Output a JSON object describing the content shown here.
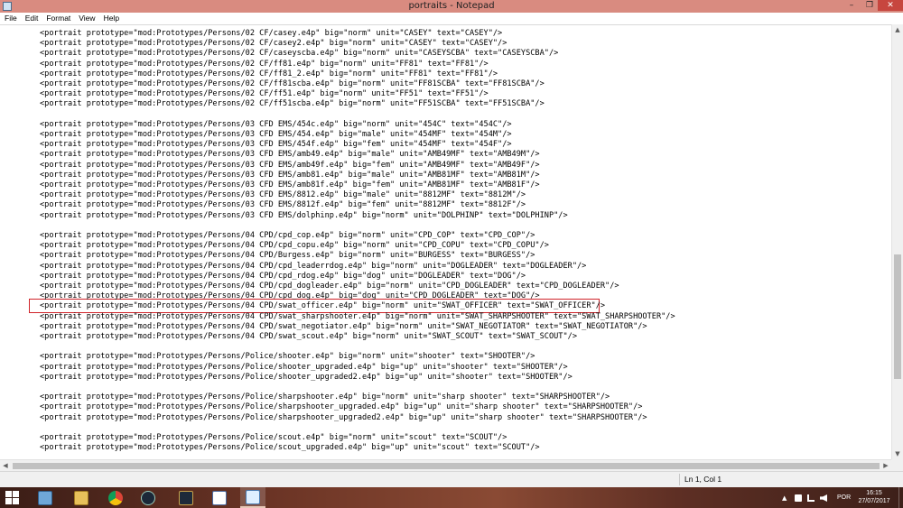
{
  "window": {
    "title": "portraits - Notepad",
    "minimize_glyph": "–",
    "maximize_glyph": "❐",
    "close_glyph": "✕"
  },
  "menu": [
    "File",
    "Edit",
    "Format",
    "View",
    "Help"
  ],
  "editor": {
    "lines": [
      "<portrait prototype=\"mod:Prototypes/Persons/02 CF/casey.e4p\" big=\"norm\" unit=\"CASEY\" text=\"CASEY\"/>",
      "<portrait prototype=\"mod:Prototypes/Persons/02 CF/casey2.e4p\" big=\"norm\" unit=\"CASEY\" text=\"CASEY\"/>",
      "<portrait prototype=\"mod:Prototypes/Persons/02 CF/caseyscba.e4p\" big=\"norm\" unit=\"CASEYSCBA\" text=\"CASEYSCBA\"/>",
      "<portrait prototype=\"mod:Prototypes/Persons/02 CF/ff81.e4p\" big=\"norm\" unit=\"FF81\" text=\"FF81\"/>",
      "<portrait prototype=\"mod:Prototypes/Persons/02 CF/ff81_2.e4p\" big=\"norm\" unit=\"FF81\" text=\"FF81\"/>",
      "<portrait prototype=\"mod:Prototypes/Persons/02 CF/ff81scba.e4p\" big=\"norm\" unit=\"FF81SCBA\" text=\"FF81SCBA\"/>",
      "<portrait prototype=\"mod:Prototypes/Persons/02 CF/ff51.e4p\" big=\"norm\" unit=\"FF51\" text=\"FF51\"/>",
      "<portrait prototype=\"mod:Prototypes/Persons/02 CF/ff51scba.e4p\" big=\"norm\" unit=\"FF51SCBA\" text=\"FF51SCBA\"/>",
      "",
      "<portrait prototype=\"mod:Prototypes/Persons/03 CFD EMS/454c.e4p\" big=\"norm\" unit=\"454C\" text=\"454C\"/>",
      "<portrait prototype=\"mod:Prototypes/Persons/03 CFD EMS/454.e4p\" big=\"male\" unit=\"454MF\" text=\"454M\"/>",
      "<portrait prototype=\"mod:Prototypes/Persons/03 CFD EMS/454f.e4p\" big=\"fem\" unit=\"454MF\" text=\"454F\"/>",
      "<portrait prototype=\"mod:Prototypes/Persons/03 CFD EMS/amb49.e4p\" big=\"male\" unit=\"AMB49MF\" text=\"AMB49M\"/>",
      "<portrait prototype=\"mod:Prototypes/Persons/03 CFD EMS/amb49f.e4p\" big=\"fem\" unit=\"AMB49MF\" text=\"AMB49F\"/>",
      "<portrait prototype=\"mod:Prototypes/Persons/03 CFD EMS/amb81.e4p\" big=\"male\" unit=\"AMB81MF\" text=\"AMB81M\"/>",
      "<portrait prototype=\"mod:Prototypes/Persons/03 CFD EMS/amb81f.e4p\" big=\"fem\" unit=\"AMB81MF\" text=\"AMB81F\"/>",
      "<portrait prototype=\"mod:Prototypes/Persons/03 CFD EMS/8812.e4p\" big=\"male\" unit=\"8812MF\" text=\"8812M\"/>",
      "<portrait prototype=\"mod:Prototypes/Persons/03 CFD EMS/8812f.e4p\" big=\"fem\" unit=\"8812MF\" text=\"8812F\"/>",
      "<portrait prototype=\"mod:Prototypes/Persons/03 CFD EMS/dolphinp.e4p\" big=\"norm\" unit=\"DOLPHINP\" text=\"DOLPHINP\"/>",
      "",
      "<portrait prototype=\"mod:Prototypes/Persons/04 CPD/cpd_cop.e4p\" big=\"norm\" unit=\"CPD_COP\" text=\"CPD_COP\"/>",
      "<portrait prototype=\"mod:Prototypes/Persons/04 CPD/cpd_copu.e4p\" big=\"norm\" unit=\"CPD_COPU\" text=\"CPD_COPU\"/>",
      "<portrait prototype=\"mod:Prototypes/Persons/04 CPD/Burgess.e4p\" big=\"norm\" unit=\"BURGESS\" text=\"BURGESS\"/>",
      "<portrait prototype=\"mod:Prototypes/Persons/04 CPD/cpd_leaderrdog.e4p\" big=\"norm\" unit=\"DOGLEADER\" text=\"DOGLEADER\"/>",
      "<portrait prototype=\"mod:Prototypes/Persons/04 CPD/cpd_rdog.e4p\" big=\"dog\" unit=\"DOGLEADER\" text=\"DOG\"/>",
      "<portrait prototype=\"mod:Prototypes/Persons/04 CPD/cpd_dogleader.e4p\" big=\"norm\" unit=\"CPD_DOGLEADER\" text=\"CPD_DOGLEADER\"/>",
      "<portrait prototype=\"mod:Prototypes/Persons/04 CPD/cpd_dog.e4p\" big=\"dog\" unit=\"CPD_DOGLEADER\" text=\"DOG\"/>",
      "<portrait prototype=\"mod:Prototypes/Persons/04 CPD/swat_officer.e4p\" big=\"norm\" unit=\"SWAT_OFFICER\" text=\"SWAT_OFFICER\"/>",
      "<portrait prototype=\"mod:Prototypes/Persons/04 CPD/swat_sharpshooter.e4p\" big=\"norm\" unit=\"SWAT_SHARPSHOOTER\" text=\"SWAT_SHARPSHOOTER\"/>",
      "<portrait prototype=\"mod:Prototypes/Persons/04 CPD/swat_negotiator.e4p\" big=\"norm\" unit=\"SWAT_NEGOTIATOR\" text=\"SWAT_NEGOTIATOR\"/>",
      "<portrait prototype=\"mod:Prototypes/Persons/04 CPD/swat_scout.e4p\" big=\"norm\" unit=\"SWAT_SCOUT\" text=\"SWAT_SCOUT\"/>",
      "",
      "<portrait prototype=\"mod:Prototypes/Persons/Police/shooter.e4p\" big=\"norm\" unit=\"shooter\" text=\"SHOOTER\"/>",
      "<portrait prototype=\"mod:Prototypes/Persons/Police/shooter_upgraded.e4p\" big=\"up\" unit=\"shooter\" text=\"SHOOTER\"/>",
      "<portrait prototype=\"mod:Prototypes/Persons/Police/shooter_upgraded2.e4p\" big=\"up\" unit=\"shooter\" text=\"SHOOTER\"/>",
      "",
      "<portrait prototype=\"mod:Prototypes/Persons/Police/sharpshooter.e4p\" big=\"norm\" unit=\"sharp shooter\" text=\"SHARPSHOOTER\"/>",
      "<portrait prototype=\"mod:Prototypes/Persons/Police/sharpshooter_upgraded.e4p\" big=\"up\" unit=\"sharp shooter\" text=\"SHARPSHOOTER\"/>",
      "<portrait prototype=\"mod:Prototypes/Persons/Police/sharpshooter_upgraded2.e4p\" big=\"up\" unit=\"sharp shooter\" text=\"SHARPSHOOTER\"/>",
      "",
      "<portrait prototype=\"mod:Prototypes/Persons/Police/scout.e4p\" big=\"norm\" unit=\"scout\" text=\"SCOUT\"/>",
      "<portrait prototype=\"mod:Prototypes/Persons/Police/scout_upgraded.e4p\" big=\"up\" unit=\"scout\" text=\"SCOUT\"/>"
    ],
    "highlighted_line_index": 27,
    "highlight_color": "#d0242a"
  },
  "statusbar": {
    "position": "Ln 1, Col 1"
  },
  "taskbar": {
    "apps": [
      {
        "name": "file-explorer",
        "icon": "folder-icon"
      },
      {
        "name": "chrome",
        "icon": "chrome-icon"
      },
      {
        "name": "steam",
        "icon": "steam-icon"
      },
      {
        "name": "game",
        "icon": "game-icon"
      },
      {
        "name": "paint",
        "icon": "paint-icon"
      },
      {
        "name": "notepad",
        "icon": "notepad-icon"
      }
    ],
    "language": "POR",
    "time": "16:15",
    "date": "27/07/2017"
  }
}
